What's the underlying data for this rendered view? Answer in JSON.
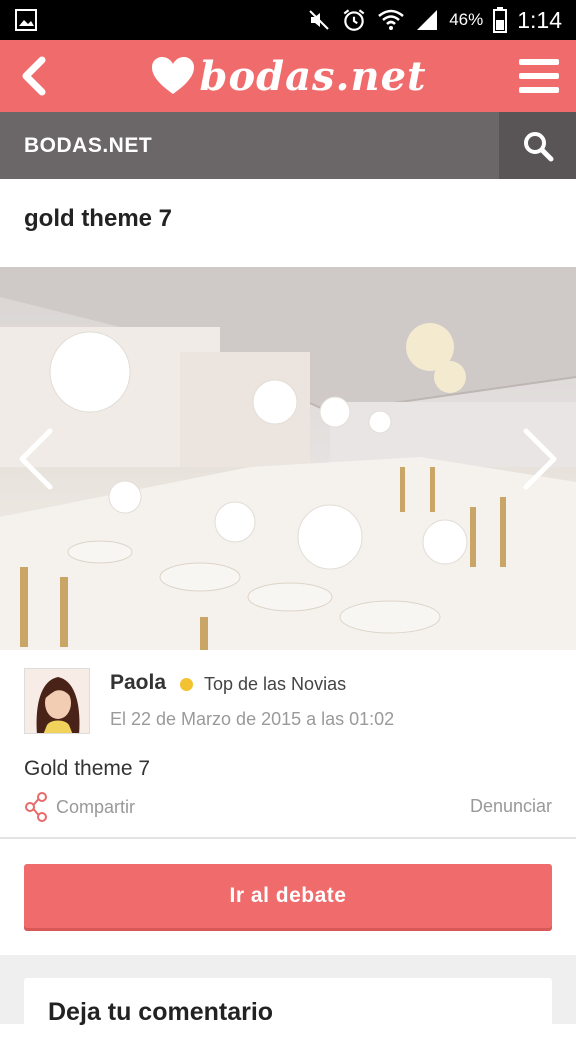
{
  "status_bar": {
    "battery_pct": "46%",
    "time": "1:14",
    "icons": [
      "gallery-icon",
      "mute-icon",
      "alarm-icon",
      "wifi-icon",
      "signal-icon",
      "battery-icon"
    ]
  },
  "header": {
    "logo_text": "bodas.net",
    "back_icon": "chevron-left-icon",
    "menu_icon": "hamburger-icon",
    "brand_color": "#f06c6c"
  },
  "section": {
    "title": "BODAS.NET",
    "search_icon": "search-icon",
    "bar_color": "#6b6768"
  },
  "post": {
    "title": "gold theme 7",
    "author": "Paola",
    "badge": "Top de las Novias",
    "date": "El 22 de Marzo de 2015 a las 01:02",
    "body": "Gold theme 7",
    "share_label": "Compartir",
    "report_label": "Denunciar"
  },
  "cta": {
    "label": "Ir al debate"
  },
  "comment": {
    "title": "Deja tu comentario"
  }
}
